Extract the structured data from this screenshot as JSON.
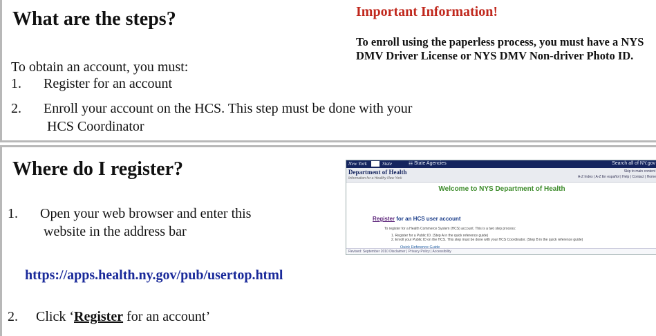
{
  "steps_panel": {
    "heading": "What are the steps?",
    "intro": "To obtain an account, you must:",
    "items": [
      {
        "num": "1.",
        "text": "Register for an account"
      },
      {
        "num": "2.",
        "text": "Enroll your account on the HCS.  This step must be done with your"
      }
    ],
    "item2_continuation": "HCS Coordinator",
    "important_title": "Important Information!",
    "important_text": "To enroll using the paperless process, you must have a NYS DMV Driver License or NYS DMV Non-driver Photo ID."
  },
  "register_panel": {
    "heading": "Where do I register?",
    "step1_num": "1.",
    "step1_line1": "Open your web browser and enter this",
    "step1_line2": "website in the address bar",
    "url": "https://apps.health.ny.gov/pub/usertop.html",
    "step2_num": "2.",
    "step2_prefix": "Click ‘",
    "step2_bold": "Register",
    "step2_suffix": " for an account’"
  },
  "thumbnail": {
    "bar_left": "New York",
    "bar_state": "State",
    "bar_agencies": "State Agencies",
    "bar_search": "Search all of NY.gov",
    "dept": "Department of Health",
    "dept_sub": "Information for a Healthy New York",
    "skip": "Skip to main content",
    "links": "A-Z Index | A-Z En español | Help | Contact | Home",
    "welcome": "Welcome to NYS Department of Health",
    "register_link": "Register",
    "register_rest": " for an HCS user account",
    "line1": "To register for a Health Commerce System (HCS) account. This is a two step process:",
    "line2": "1. Register for a Public ID. (Step A in the quick reference guide)",
    "line3": "2. Enroll your Public ID on the HCS. This step must be done with your HCS Coordinator. (Step B in the quick reference guide)",
    "qrg": "Quick Reference Guide",
    "footer": "Revised: September 2010  Disclaimer | Privacy Policy | Accessibility"
  },
  "colors": {
    "important_red": "#c0281d",
    "url_blue": "#1a2a9a",
    "border_gray": "#b8b8b8",
    "nys_navy": "#14245e",
    "welcome_green": "#3c8b2a"
  }
}
